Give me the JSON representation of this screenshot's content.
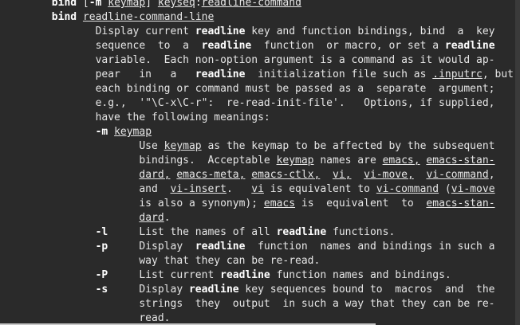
{
  "lines": [
    [
      {
        "t": "       "
      },
      {
        "t": "bind",
        "s": "b"
      },
      {
        "t": " ["
      },
      {
        "t": "-m",
        "s": "b"
      },
      {
        "t": " "
      },
      {
        "t": "keymap",
        "s": "u"
      },
      {
        "t": "] "
      },
      {
        "t": "keyseq",
        "s": "u"
      },
      {
        "t": ":"
      },
      {
        "t": "readline-command",
        "s": "u"
      }
    ],
    [
      {
        "t": "       "
      },
      {
        "t": "bind",
        "s": "b"
      },
      {
        "t": " "
      },
      {
        "t": "readline-command-line",
        "s": "u"
      }
    ],
    [
      {
        "t": "              Display current "
      },
      {
        "t": "readline",
        "s": "b"
      },
      {
        "t": " key and function bindings, bind  a  key"
      }
    ],
    [
      {
        "t": "              sequence  to  a  "
      },
      {
        "t": "readline",
        "s": "b"
      },
      {
        "t": "  function  or macro, or set a "
      },
      {
        "t": "readline",
        "s": "b"
      }
    ],
    [
      {
        "t": "              variable.  Each non-option argument is a command as it would ap‐"
      }
    ],
    [
      {
        "t": "              pear   in   a   "
      },
      {
        "t": "readline",
        "s": "b"
      },
      {
        "t": "  initialization file such as "
      },
      {
        "t": ".inputrc",
        "s": "u"
      },
      {
        "t": ", but"
      }
    ],
    [
      {
        "t": "              each binding or command must be passed as a  separate  argument;"
      }
    ],
    [
      {
        "t": "              e.g.,  '\"\\C-x\\C-r\":  re-read-init-file'.   Options, if supplied,"
      }
    ],
    [
      {
        "t": "              have the following meanings:"
      }
    ],
    [
      {
        "t": "              "
      },
      {
        "t": "-m",
        "s": "b"
      },
      {
        "t": " "
      },
      {
        "t": "keymap",
        "s": "u"
      }
    ],
    [
      {
        "t": "                     Use "
      },
      {
        "t": "keymap",
        "s": "u"
      },
      {
        "t": " as the keymap to be affected by the subsequent"
      }
    ],
    [
      {
        "t": "                     bindings.  Acceptable "
      },
      {
        "t": "keymap",
        "s": "u"
      },
      {
        "t": " names are "
      },
      {
        "t": "emacs,",
        "s": "u"
      },
      {
        "t": " "
      },
      {
        "t": "emacs-stan‐",
        "s": "u"
      }
    ],
    [
      {
        "t": "                     "
      },
      {
        "t": "dard,",
        "s": "u"
      },
      {
        "t": " "
      },
      {
        "t": "emacs-meta,",
        "s": "u"
      },
      {
        "t": " "
      },
      {
        "t": "emacs-ctlx,",
        "s": "u"
      },
      {
        "t": "  "
      },
      {
        "t": "vi,",
        "s": "u"
      },
      {
        "t": "  "
      },
      {
        "t": "vi-move,",
        "s": "u"
      },
      {
        "t": "  "
      },
      {
        "t": "vi-command",
        "s": "u"
      },
      {
        "t": ","
      }
    ],
    [
      {
        "t": "                     and  "
      },
      {
        "t": "vi-insert",
        "s": "u"
      },
      {
        "t": ".   "
      },
      {
        "t": "vi",
        "s": "u"
      },
      {
        "t": " is equivalent to "
      },
      {
        "t": "vi-command",
        "s": "u"
      },
      {
        "t": " ("
      },
      {
        "t": "vi-move",
        "s": "u"
      }
    ],
    [
      {
        "t": "                     is also a synonym); "
      },
      {
        "t": "emacs",
        "s": "u"
      },
      {
        "t": " is  equivalent  to  "
      },
      {
        "t": "emacs-stan‐",
        "s": "u"
      }
    ],
    [
      {
        "t": "                     "
      },
      {
        "t": "dard",
        "s": "u"
      },
      {
        "t": "."
      }
    ],
    [
      {
        "t": "              "
      },
      {
        "t": "-l",
        "s": "b"
      },
      {
        "t": "     List the names of all "
      },
      {
        "t": "readline",
        "s": "b"
      },
      {
        "t": " functions."
      }
    ],
    [
      {
        "t": "              "
      },
      {
        "t": "-p",
        "s": "b"
      },
      {
        "t": "     Display  "
      },
      {
        "t": "readline",
        "s": "b"
      },
      {
        "t": "  function  names and bindings in such a"
      }
    ],
    [
      {
        "t": "                     way that they can be re-read."
      }
    ],
    [
      {
        "t": "              "
      },
      {
        "t": "-P",
        "s": "b"
      },
      {
        "t": "     List current "
      },
      {
        "t": "readline",
        "s": "b"
      },
      {
        "t": " function names and bindings."
      }
    ],
    [
      {
        "t": "              "
      },
      {
        "t": "-s",
        "s": "b"
      },
      {
        "t": "     Display "
      },
      {
        "t": "readline",
        "s": "b"
      },
      {
        "t": " key sequences bound to  macros  and  the"
      }
    ],
    [
      {
        "t": "                     strings  they  output  in such a way that they can be re-"
      }
    ],
    [
      {
        "t": "                     read."
      }
    ]
  ]
}
